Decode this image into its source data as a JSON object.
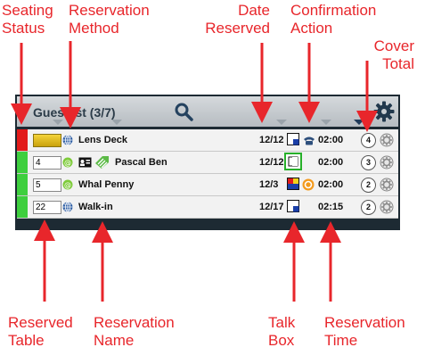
{
  "annotations": {
    "seating_status": [
      "Seating",
      "Status"
    ],
    "reservation_method": [
      "Reservation",
      "Method"
    ],
    "date_reserved": [
      "Date",
      "Reserved"
    ],
    "confirmation_action": [
      "Confirmation",
      "Action"
    ],
    "cover_total": [
      "Cover",
      "Total"
    ],
    "reserved_table": [
      "Reserved",
      "Table"
    ],
    "reservation_name": [
      "Reservation",
      "Name"
    ],
    "talk_box": [
      "Talk",
      "Box"
    ],
    "reservation_time": [
      "Reservation",
      "Time"
    ]
  },
  "header": {
    "title": "Guestlist (3/7)",
    "search_icon": "magnifier-icon",
    "settings_icon": "gear-icon"
  },
  "rows": [
    {
      "status_color": "#e21b1b",
      "table": "",
      "method": "web",
      "name": "Lens Deck",
      "date": "12/12",
      "talk": "blue-corner",
      "confirmation": "phone",
      "time": "02:00",
      "covers": "4"
    },
    {
      "status_color": "#3ecf3e",
      "table": "4",
      "method": "email",
      "name": "Pascal Ben",
      "date": "12/12",
      "talk": "green-frame",
      "confirmation": "",
      "time": "02:00",
      "covers": "3"
    },
    {
      "status_color": "#3ecf3e",
      "table": "5",
      "method": "email",
      "name": "Whal Penny",
      "date": "12/3",
      "talk": "multi-color",
      "confirmation": "orange-badge",
      "time": "02:00",
      "covers": "2"
    },
    {
      "status_color": "#3ecf3e",
      "table": "22",
      "method": "web",
      "name": "Walk-in",
      "date": "12/17",
      "talk": "blue-corner",
      "confirmation": "",
      "time": "02:15",
      "covers": "2"
    }
  ],
  "colors": {
    "annotation_red": "#e8262b",
    "panel_dark": "#1d2a33",
    "status_red": "#e21b1b",
    "status_green": "#3ecf3e"
  }
}
